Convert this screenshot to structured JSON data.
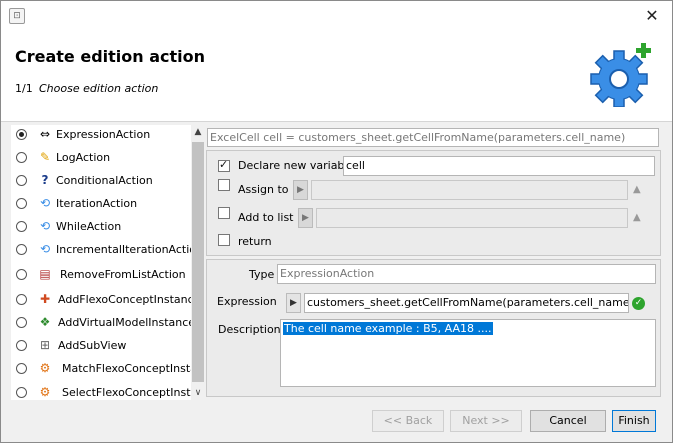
{
  "header": {
    "title": "Create edition action",
    "step": "1/1",
    "subtitle": "Choose edition action"
  },
  "actions": [
    {
      "label": "ExpressionAction",
      "icon": "expression-icon",
      "selected": true
    },
    {
      "label": "LogAction",
      "icon": "pencil-icon",
      "selected": false
    },
    {
      "label": "ConditionalAction",
      "icon": "question-icon",
      "selected": false
    },
    {
      "label": "IterationAction",
      "icon": "loop-icon",
      "selected": false
    },
    {
      "label": "WhileAction",
      "icon": "loop-icon",
      "selected": false
    },
    {
      "label": "IncrementalIterationAction",
      "icon": "loop-icon",
      "selected": false
    },
    {
      "label": "RemoveFromListAction",
      "icon": "list-remove-icon",
      "selected": false
    },
    {
      "label": "AddFlexoConceptInstance",
      "icon": "concept-add-icon",
      "selected": false
    },
    {
      "label": "AddVirtualModelInstance",
      "icon": "model-add-icon",
      "selected": false
    },
    {
      "label": "AddSubView",
      "icon": "subview-icon",
      "selected": false
    },
    {
      "label": "MatchFlexoConceptInstance",
      "icon": "match-icon",
      "selected": false
    },
    {
      "label": "SelectFlexoConceptInstance",
      "icon": "select-icon",
      "selected": false
    }
  ],
  "expression_summary": "ExcelCell cell = customers_sheet.getCellFromName(parameters.cell_name)",
  "declare": {
    "label": "Declare new variable",
    "checked": true,
    "value": "cell"
  },
  "assign": {
    "label": "Assign to",
    "checked": false
  },
  "add_to_list": {
    "label": "Add to list",
    "checked": false
  },
  "return": {
    "label": "return",
    "checked": false
  },
  "type": {
    "label": "Type",
    "value": "ExpressionAction"
  },
  "expression": {
    "label": "Expression",
    "value": "customers_sheet.getCellFromName(parameters.cell_name)"
  },
  "description": {
    "label": "Description",
    "value": "The cell name example : B5, AA18 ...."
  },
  "buttons": {
    "back": "<< Back",
    "next": "Next >>",
    "cancel": "Cancel",
    "finish": "Finish"
  },
  "colors": {
    "selection": "#0078d7",
    "valid": "#2ea42e"
  }
}
